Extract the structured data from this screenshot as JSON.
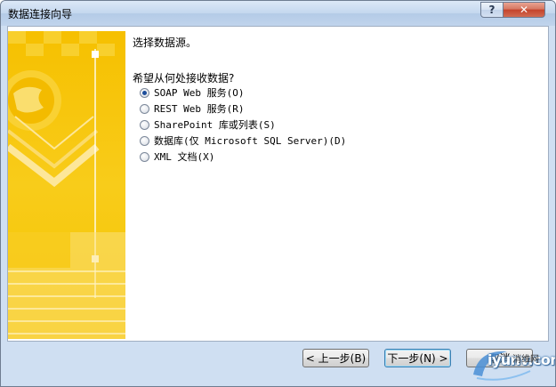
{
  "window": {
    "title": "数据连接向导",
    "help_glyph": "?",
    "close_glyph": "✕"
  },
  "main": {
    "heading": "选择数据源。",
    "question": "希望从何处接收数据?",
    "options": [
      {
        "label": "SOAP Web 服务(O)",
        "selected": true
      },
      {
        "label": "REST Web 服务(R)",
        "selected": false
      },
      {
        "label": "SharePoint 库或列表(S)",
        "selected": false
      },
      {
        "label": "数据库(仅 Microsoft SQL Server)(D)",
        "selected": false
      },
      {
        "label": "XML 文档(X)",
        "selected": false
      }
    ]
  },
  "buttons": {
    "back": "< 上一步(B)",
    "next": "下一步(N) >",
    "cancel": "取消"
  },
  "watermark": {
    "site": "iyunv.com",
    "cn": "消维网"
  },
  "colors": {
    "accent_yellow": "#f6c400",
    "panel_yellow": "#fbe27a",
    "radio_dot": "#1d4e9b"
  }
}
